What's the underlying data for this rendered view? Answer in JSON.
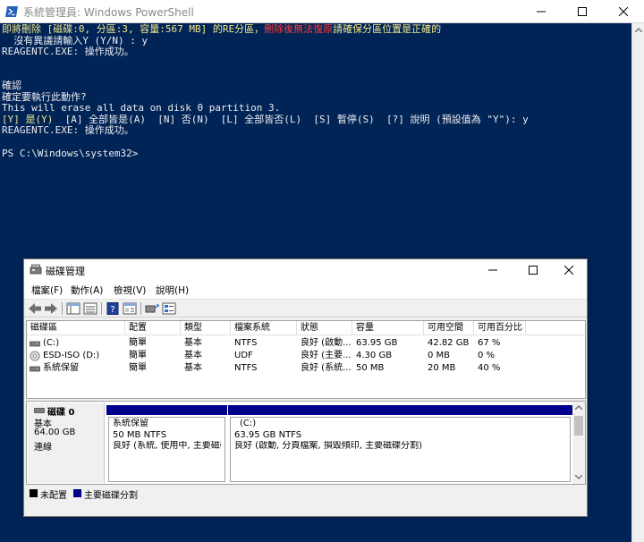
{
  "powershell": {
    "title": "系統管理員: Windows PowerShell",
    "lines": [
      {
        "segments": [
          {
            "text": "即將刪除 [",
            "color": "yellow"
          },
          {
            "text": "磁碟:0, 分區:3, 容量:567 MB",
            "color": "yellow"
          },
          {
            "text": "] 的RE分區，",
            "color": "yellow"
          },
          {
            "text": "刪除後無法復原",
            "color": "red"
          },
          {
            "text": "請確保分區位置是正確的",
            "color": "yellow"
          }
        ]
      },
      {
        "segments": [
          {
            "text": "  沒有異議請輸入Y (Y/N) : y",
            "color": "white"
          }
        ]
      },
      {
        "segments": [
          {
            "text": "REAGENTC.EXE: 操作成功。",
            "color": "white"
          }
        ]
      },
      {
        "segments": [
          {
            "text": "",
            "color": "white"
          }
        ]
      },
      {
        "segments": [
          {
            "text": "",
            "color": "white"
          }
        ]
      },
      {
        "segments": [
          {
            "text": "確認",
            "color": "white"
          }
        ]
      },
      {
        "segments": [
          {
            "text": "確定要執行此動作?",
            "color": "white"
          }
        ]
      },
      {
        "segments": [
          {
            "text": "This will erase all data on disk 0 partition 3.",
            "color": "white"
          }
        ]
      },
      {
        "segments": [
          {
            "text": "[Y] 是(Y)",
            "color": "yellow"
          },
          {
            "text": "  [A] 全部皆是(A)  [N] 否(N)  [L] 全部皆否(L)  [S] 暫停(S)  [?] 說明 (預設值為 \"Y\"): y",
            "color": "white"
          }
        ]
      },
      {
        "segments": [
          {
            "text": "REAGENTC.EXE: 操作成功。",
            "color": "white"
          }
        ]
      },
      {
        "segments": [
          {
            "text": "",
            "color": "white"
          }
        ]
      },
      {
        "segments": [
          {
            "text": "PS C:\\Windows\\system32>",
            "color": "white"
          }
        ]
      }
    ]
  },
  "disk_management": {
    "title": "磁碟管理",
    "menu": [
      "檔案(F)",
      "動作(A)",
      "檢視(V)",
      "說明(H)"
    ],
    "columns": [
      "磁碟區",
      "配置",
      "類型",
      "檔案系統",
      "狀態",
      "容量",
      "可用空間",
      "可用百分比"
    ],
    "volumes": [
      {
        "icon": "drive-icon",
        "name": "(C:)",
        "layout": "簡單",
        "type": "基本",
        "fs": "NTFS",
        "status": "良好 (啟動...",
        "capacity": "63.95 GB",
        "free": "42.82 GB",
        "pct": "67 %"
      },
      {
        "icon": "cd-drive-icon",
        "name": "ESD-ISO (D:)",
        "layout": "簡單",
        "type": "基本",
        "fs": "UDF",
        "status": "良好 (主要...",
        "capacity": "4.30 GB",
        "free": "0 MB",
        "pct": "0 %"
      },
      {
        "icon": "drive-icon",
        "name": "系統保留",
        "layout": "簡單",
        "type": "基本",
        "fs": "NTFS",
        "status": "良好 (系統...",
        "capacity": "50 MB",
        "free": "20 MB",
        "pct": "40 %"
      }
    ],
    "disk": {
      "name": "磁碟 0",
      "kind": "基本",
      "size": "64.00 GB",
      "state": "連線"
    },
    "partitions": [
      {
        "name": "系統保留",
        "size": "50 MB NTFS",
        "status": "良好 (系統, 使用中, 主要磁碟"
      },
      {
        "name": "(C:)",
        "size": "63.95 GB NTFS",
        "status": "良好 (啟動, 分頁檔案, 損毀傾印, 主要磁碟分割)"
      }
    ],
    "legend": [
      {
        "label": "未配置",
        "color": "#000000"
      },
      {
        "label": "主要磁碟分割",
        "color": "#00008b"
      }
    ]
  }
}
